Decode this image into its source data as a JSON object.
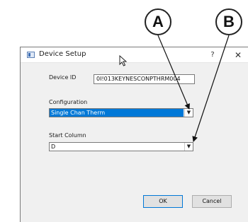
{
  "window": {
    "title": "Device Setup",
    "help_glyph": "?",
    "close_glyph": "✕"
  },
  "form": {
    "device_id": {
      "label": "Device ID",
      "value": "0I!013KEYNESCONPTHRM004"
    },
    "configuration": {
      "label": "Configuration",
      "value": "Single Chan Therm"
    },
    "start_column": {
      "label": "Start Column",
      "value": "D"
    }
  },
  "buttons": {
    "ok": "OK",
    "cancel": "Cancel"
  },
  "callouts": {
    "a": "A",
    "b": "B"
  },
  "icons": {
    "dropdown": "chevron-down-icon",
    "cursor": "mouse-pointer-icon",
    "app": "window-app-icon"
  },
  "colors": {
    "selection": "#0078d7",
    "dialog_bg": "#f0f0f0"
  }
}
